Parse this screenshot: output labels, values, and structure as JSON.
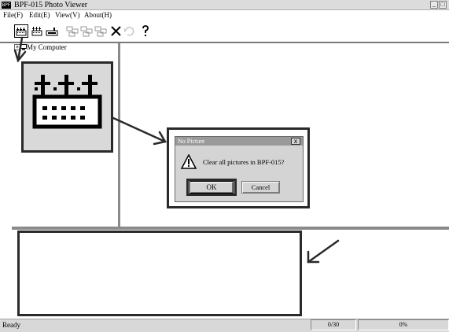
{
  "window": {
    "title": "BPF-015 Photo Viewer",
    "icon_text": "BPF",
    "minimize_label": "_",
    "maximize_label": "□"
  },
  "menu": [
    {
      "label": "File(F)"
    },
    {
      "label": "Edit(E)"
    },
    {
      "label": "View(V)"
    },
    {
      "label": "About(H)"
    }
  ],
  "toolbar": {
    "buttons": [
      {
        "icon": "camera-download-icon"
      },
      {
        "icon": "clear-camera-icon"
      },
      {
        "icon": "camera-upload-icon"
      },
      {
        "icon": "stack-icon"
      },
      {
        "icon": "stack-icon"
      },
      {
        "icon": "stack-icon"
      },
      {
        "icon": "delete-icon"
      },
      {
        "icon": "undo-icon"
      },
      {
        "icon": "help-icon"
      }
    ]
  },
  "tree": {
    "expander": "+",
    "root_label": "My Computer"
  },
  "dialog": {
    "title": "No Picture",
    "close_label": "x",
    "message": "Clear all pictures in BPF-015?",
    "ok_label": "OK",
    "cancel_label": "Cancel"
  },
  "statusbar": {
    "status": "Ready",
    "count": "0/30",
    "progress": "0%"
  }
}
